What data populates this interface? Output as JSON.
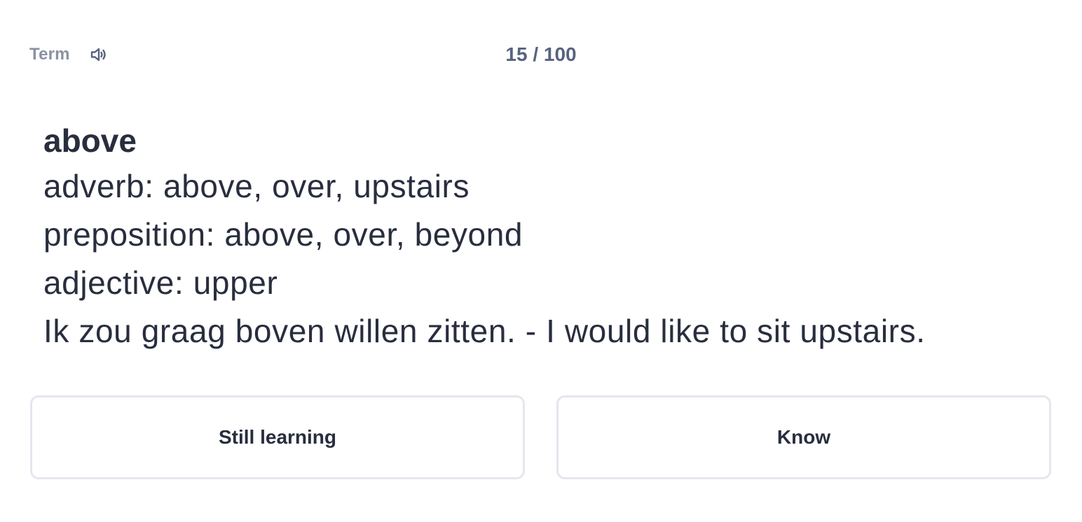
{
  "header": {
    "term_label": "Term",
    "audio_icon": "speaker-icon",
    "counter": "15 / 100"
  },
  "card": {
    "term": "above",
    "definitions": [
      "adverb: above, over, upstairs",
      "preposition: above, over, beyond",
      "adjective: upper",
      "Ik zou graag boven willen zitten. - I would like to sit upstairs."
    ]
  },
  "actions": {
    "still_learning_label": "Still learning",
    "know_label": "Know"
  }
}
